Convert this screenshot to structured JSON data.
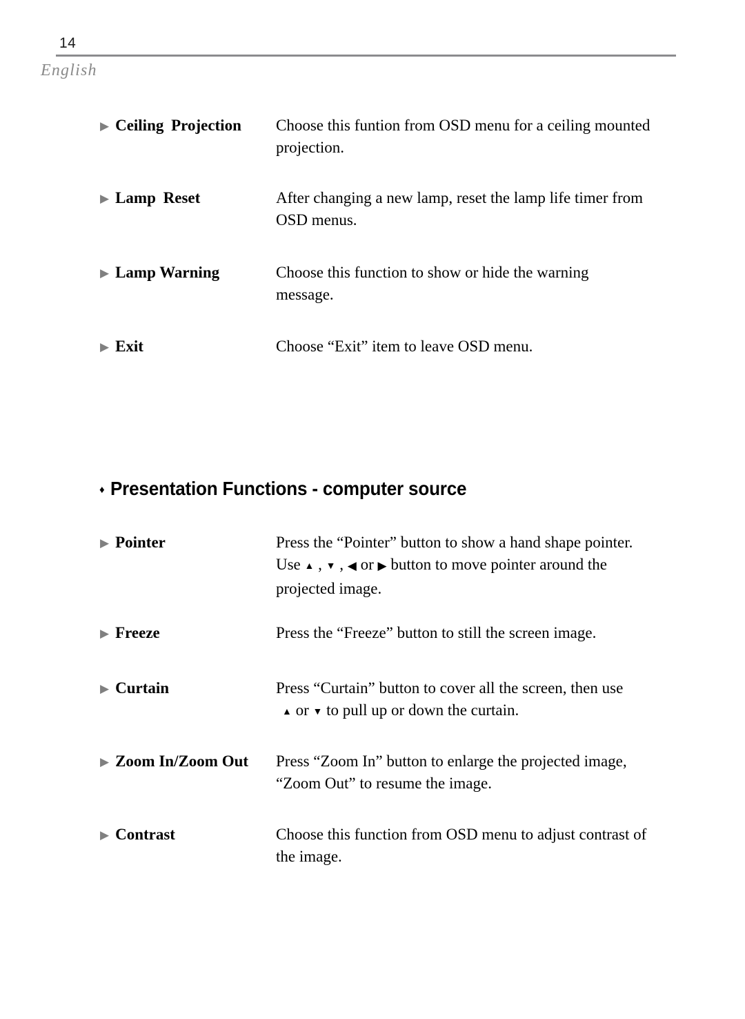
{
  "header": {
    "page_number": "14",
    "language": "English",
    "rule_color": "#8b8b8e",
    "language_color": "#8a8a8a"
  },
  "glyphs": {
    "term_bullet": "▶",
    "heading_bullet": "♦",
    "arrow_up": "▲",
    "arrow_down": "▼",
    "arrow_left": "◀",
    "arrow_right": "▶"
  },
  "sections": [
    {
      "entries": [
        {
          "term": "Ceiling Projection",
          "lines": [
            "Choose this funtion from OSD menu for a ceiling mounted",
            "projection."
          ]
        },
        {
          "term": "Lamp Reset",
          "lines": [
            "After changing a new lamp, reset the lamp life timer from",
            "OSD menus."
          ]
        },
        {
          "term": "Lamp Warning",
          "lines": [
            "Choose this function to show or hide the warning",
            "message."
          ]
        },
        {
          "term": "Exit",
          "lines": [
            "Choose “Exit” item to leave OSD menu."
          ]
        }
      ]
    },
    {
      "heading": "Presentation Functions - computer source",
      "entries": [
        {
          "term": "Pointer",
          "lines": [
            "Press the “Pointer” button to show a hand shape pointer.",
            "Use ▲, ▼, ◀ or ▶ button to move pointer around the",
            "projected image."
          ],
          "line_parts": [
            null,
            [
              "Use ",
              "▲",
              " , ",
              "▼",
              " , ",
              "◀",
              " or ",
              "▶",
              " button to move pointer around the"
            ],
            null
          ]
        },
        {
          "term": "Freeze",
          "lines": [
            "Press the “Freeze” button to still the screen image."
          ]
        },
        {
          "term": "Curtain",
          "lines": [
            "Press “Curtain” button to cover all the screen, then use",
            "▲ or ▼ to pull up or down the curtain."
          ],
          "line_parts": [
            null,
            [
              "",
              "▲",
              " or ",
              "▼",
              " to pull up or down the curtain."
            ]
          ]
        },
        {
          "term": "Zoom In/Zoom Out",
          "lines": [
            "Press “Zoom In” button to enlarge the projected image,",
            "“Zoom Out” to resume the image."
          ]
        },
        {
          "term": "Contrast",
          "lines": [
            "Choose this function from OSD menu to adjust contrast of",
            "the image."
          ]
        }
      ]
    }
  ]
}
